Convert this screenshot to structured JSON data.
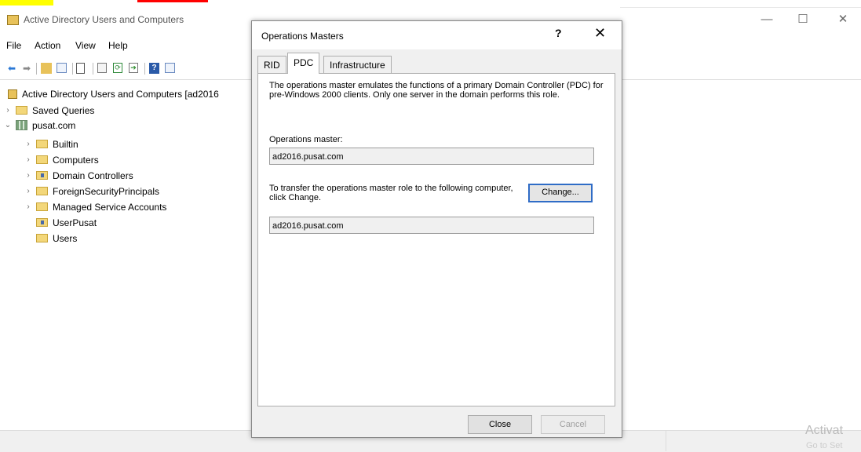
{
  "window": {
    "title": "Active Directory Users and Computers",
    "minimize_glyph": "—",
    "maximize_glyph": "☐",
    "close_glyph": "✕"
  },
  "menu": [
    "File",
    "Action",
    "View",
    "Help"
  ],
  "tree": {
    "root": "Active Directory Users and Computers [ad2016",
    "items": [
      {
        "label": "Saved Queries",
        "expander": "›",
        "icon": "folder-icon"
      },
      {
        "label": "pusat.com",
        "expander": "⌄",
        "icon": "domain-icon"
      },
      {
        "label": "Builtin",
        "expander": "›",
        "icon": "folder-icon"
      },
      {
        "label": "Computers",
        "expander": "›",
        "icon": "folder-icon"
      },
      {
        "label": "Domain Controllers",
        "expander": "›",
        "icon": "ou-icon"
      },
      {
        "label": "ForeignSecurityPrincipals",
        "expander": "›",
        "icon": "folder-icon"
      },
      {
        "label": "Managed Service Accounts",
        "expander": "›",
        "icon": "folder-icon"
      },
      {
        "label": "UserPusat",
        "expander": "",
        "icon": "ou-icon"
      },
      {
        "label": "Users",
        "expander": "",
        "icon": "folder-icon"
      }
    ]
  },
  "dialog": {
    "title": "Operations Masters",
    "help_glyph": "?",
    "close_glyph": "✕",
    "tabs": [
      "RID",
      "PDC",
      "Infrastructure"
    ],
    "active_tab": "PDC",
    "description": "The operations master emulates the functions of a primary Domain Controller (PDC) for pre-Windows 2000 clients. Only one server in the domain performs this role.",
    "operations_master_label": "Operations master:",
    "operations_master_value": "ad2016.pusat.com",
    "transfer_label": "To transfer the operations master role to the following computer, click Change.",
    "change_button": "Change...",
    "target_value": "ad2016.pusat.com",
    "close_button": "Close",
    "cancel_button": "Cancel"
  },
  "watermark": {
    "line1": "Activat",
    "line2": "Go to Set"
  },
  "colors": {
    "accent_focus": "#2f6cc6",
    "folder": "#f3d77a",
    "banner_highlight": "#ffff00",
    "banner_red": "#ff0000"
  }
}
